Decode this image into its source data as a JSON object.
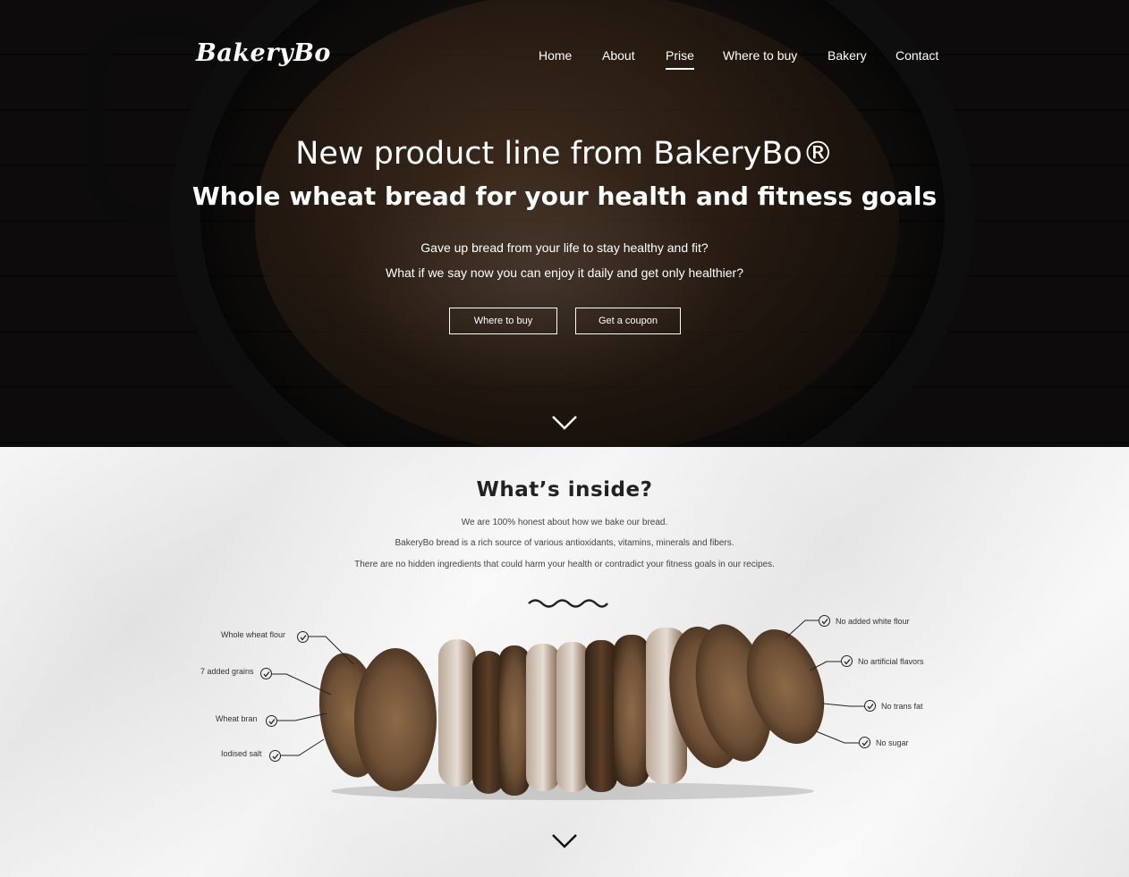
{
  "brand": "BakeryBo",
  "nav": {
    "items": [
      {
        "label": "Home",
        "active": false
      },
      {
        "label": "About",
        "active": false
      },
      {
        "label": "Prise",
        "active": true
      },
      {
        "label": "Where to buy",
        "active": false
      },
      {
        "label": "Bakery",
        "active": false
      },
      {
        "label": "Contact",
        "active": false
      }
    ]
  },
  "hero": {
    "title": "New product line from BakeryBo®",
    "subtitle": "Whole wheat bread for your health and fitness goals",
    "line1": "Gave up bread from your life to stay healthy and fit?",
    "line2": "What if we say now you can enjoy it daily and get only healthier?",
    "button_where": "Where to buy",
    "button_coupon": "Get a coupon",
    "scroll_icon": "chevron-down-icon"
  },
  "inside": {
    "title": "What’s inside?",
    "p1": "We are 100% honest about how we bake our bread.",
    "p2": "BakeryBo bread is a rich source of various antioxidants, vitamins, minerals and fibers.",
    "p3": "There are no hidden ingredients that could harm your health or contradict your fitness goals in our recipes.",
    "left_items": [
      "Whole wheat flour",
      "7 added grains",
      "Wheat bran",
      "Iodised salt"
    ],
    "right_items": [
      "No added white flour",
      "No artificial flavors",
      "No trans fat",
      "No sugar"
    ],
    "scroll_icon": "chevron-down-icon"
  },
  "colors": {
    "hero_dark": "#0f0d0c",
    "text_light": "#ffffff",
    "text_dark": "#222222",
    "paper": "#efefef"
  }
}
